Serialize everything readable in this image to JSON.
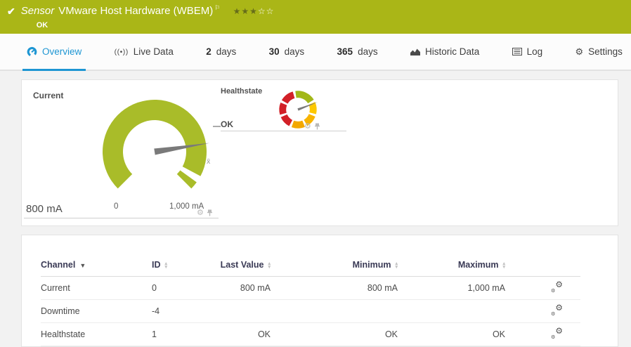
{
  "colors": {
    "brand_green": "#aab617",
    "gauge_green": "#a9bc29",
    "blue": "#1e96d3",
    "page_bg": "#f2f2f2",
    "panel_border": "#e3e3e3",
    "text_navy": "#3a3a55",
    "icon_gray": "#b9b9b9",
    "needle": "#7a7a7a",
    "star_fill": "#666c1a",
    "red": "#d22027",
    "yellow": "#fdc800"
  },
  "icons": {
    "check": "✔",
    "flag": "⚐",
    "live": "((•))",
    "gear": "⚙",
    "sort_up": "▴",
    "sort_down": "▾",
    "sort_desc": "▼"
  },
  "header": {
    "kind": "Sensor",
    "title": "VMware Host Hardware (WBEM)",
    "status": "OK",
    "priority_stars_filled": "★★★",
    "priority_stars_empty": "☆☆"
  },
  "tabs": [
    {
      "label": "Overview",
      "active": true
    },
    {
      "label": "Live Data"
    },
    {
      "num": "2",
      "label": "days"
    },
    {
      "num": "30",
      "label": "days"
    },
    {
      "num": "365",
      "label": "days"
    },
    {
      "label": "Historic Data"
    },
    {
      "label": "Log"
    },
    {
      "label": "Settings"
    }
  ],
  "chart_data": [
    {
      "type": "gauge",
      "title": "Current",
      "value": 800,
      "unit": "mA",
      "value_label": "800 mA",
      "min": 0,
      "max": 1000,
      "min_label": "0",
      "max_label": "1,000 mA",
      "needle_angle": 81,
      "avg_marker": "x̄",
      "arcs": [
        {
          "start": -135,
          "end": 118,
          "color": "#a9bc29"
        },
        {
          "start": 126,
          "end": 135,
          "color": "#a9bc29"
        }
      ]
    },
    {
      "type": "gauge",
      "title": "Healthstate",
      "value_label": "OK",
      "needle_angle": 69,
      "arcs": [
        {
          "start": -8,
          "end": 58,
          "color": "#a2b718"
        },
        {
          "start": 66,
          "end": 104,
          "color": "#fdc800"
        },
        {
          "start": 112,
          "end": 150,
          "color": "#f8b400"
        },
        {
          "start": 158,
          "end": 200,
          "color": "#f3a800"
        },
        {
          "start": 208,
          "end": 246,
          "color": "#d22027"
        },
        {
          "start": 254,
          "end": 292,
          "color": "#d22027"
        },
        {
          "start": 300,
          "end": 344,
          "color": "#d22027"
        }
      ]
    }
  ],
  "table": {
    "headers": [
      "Channel",
      "ID",
      "Last Value",
      "Minimum",
      "Maximum"
    ],
    "sort_column": "Channel",
    "rows": [
      {
        "channel": "Current",
        "id": "0",
        "last": "800 mA",
        "min": "800 mA",
        "max": "1,000 mA"
      },
      {
        "channel": "Downtime",
        "id": "-4",
        "last": "",
        "min": "",
        "max": ""
      },
      {
        "channel": "Healthstate",
        "id": "1",
        "last": "OK",
        "min": "OK",
        "max": "OK"
      }
    ]
  }
}
